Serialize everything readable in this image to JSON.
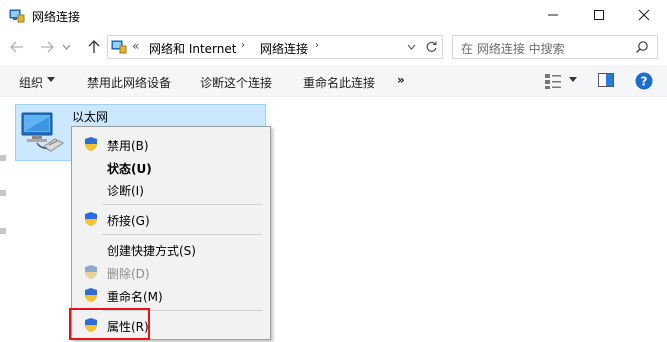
{
  "window": {
    "title": "网络连接",
    "icon": "network-connections-icon",
    "controls": [
      "minimize-icon",
      "maximize-icon",
      "close-icon"
    ]
  },
  "nav": {
    "back_icon": "arrow-left-icon",
    "forward_icon": "arrow-right-icon",
    "recent_icon": "chevron-down-icon",
    "up_icon": "arrow-up-icon"
  },
  "address": {
    "overflow": "«",
    "crumbs": [
      "网络和 Internet",
      "网络连接"
    ],
    "separator": "›",
    "refresh_icon": "refresh-icon"
  },
  "search": {
    "placeholder": "在 网络连接 中搜索"
  },
  "toolbar": {
    "organize": "组织",
    "disable_device": "禁用此网络设备",
    "diagnose": "诊断这个连接",
    "rename": "重命名此连接",
    "more": "»",
    "view_icon": "view-options-icon",
    "pane_icon": "preview-pane-icon",
    "help_icon": "help-icon"
  },
  "adapter": {
    "name": "以太网"
  },
  "context_menu": {
    "items": [
      {
        "label": "禁用(B)",
        "shield": true,
        "bold": false,
        "disabled": false
      },
      {
        "label": "状态(U)",
        "shield": false,
        "bold": true,
        "disabled": false
      },
      {
        "label": "诊断(I)",
        "shield": false,
        "bold": false,
        "disabled": false
      },
      {
        "label": "桥接(G)",
        "shield": true,
        "bold": false,
        "disabled": false
      },
      {
        "label": "创建快捷方式(S)",
        "shield": false,
        "bold": false,
        "disabled": false
      },
      {
        "label": "删除(D)",
        "shield": true,
        "bold": false,
        "disabled": true
      },
      {
        "label": "重命名(M)",
        "shield": true,
        "bold": false,
        "disabled": false
      },
      {
        "label": "属性(R)",
        "shield": true,
        "bold": false,
        "disabled": false
      }
    ]
  },
  "colors": {
    "selection_fill": "#cce8ff",
    "selection_border": "#99d1ff",
    "highlight_box": "#e0161a",
    "help_blue": "#1a6fd1"
  }
}
